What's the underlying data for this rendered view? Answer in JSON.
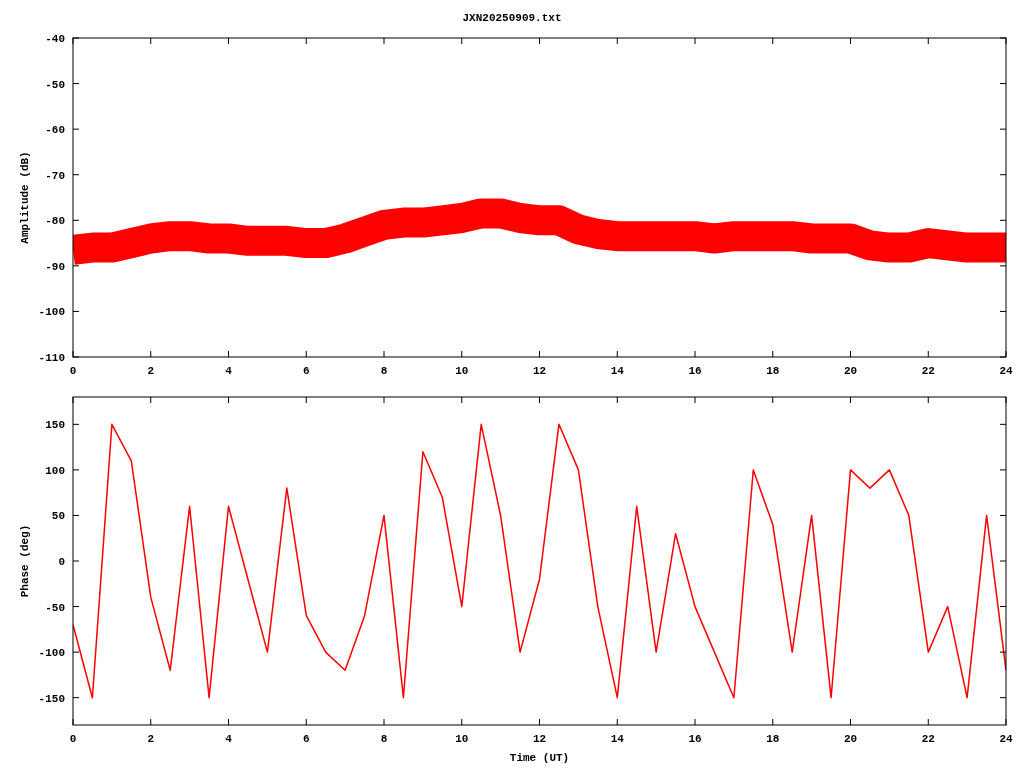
{
  "charts": [
    {
      "chart_data": {
        "type": "line",
        "title": "JXN20250909.txt",
        "ylabel": "Amplitude (dB)",
        "x": [
          0,
          0.5,
          1,
          1.5,
          2,
          2.5,
          3,
          3.5,
          4,
          4.5,
          5,
          5.5,
          6,
          6.5,
          7,
          7.5,
          8,
          8.5,
          9,
          9.5,
          10,
          10.5,
          11,
          11.5,
          12,
          12.5,
          13,
          13.5,
          14,
          14.5,
          15,
          15.5,
          16,
          16.5,
          17,
          17.5,
          18,
          18.5,
          19,
          19.5,
          20,
          20.5,
          21,
          21.5,
          22,
          22.5,
          23,
          23.5,
          24
        ],
        "series": [
          {
            "color": "#ff0000",
            "values": [
              -86.5,
              -86,
              -86,
              -85,
              -84,
              -83.5,
              -83.5,
              -84,
              -84,
              -84.5,
              -84.5,
              -84.5,
              -85,
              -85,
              -84,
              -82.5,
              -81,
              -80.5,
              -80.5,
              -80,
              -79.5,
              -78.5,
              -78.5,
              -79.5,
              -80,
              -80,
              -82,
              -83,
              -83.5,
              -83.5,
              -83.5,
              -83.5,
              -83.5,
              -84,
              -83.5,
              -83.5,
              -83.5,
              -83.5,
              -84,
              -84,
              -84,
              -85.5,
              -86,
              -86,
              -85,
              -85.5,
              -86,
              -86,
              -86
            ]
          }
        ],
        "xlim": [
          0,
          24
        ],
        "ylim": [
          -110,
          -40
        ],
        "xticks": [
          0,
          2,
          4,
          6,
          8,
          10,
          12,
          14,
          16,
          18,
          20,
          22,
          24
        ],
        "yticks": [
          -110,
          -100,
          -90,
          -80,
          -70,
          -60,
          -50,
          -40
        ]
      }
    },
    {
      "chart_data": {
        "type": "line",
        "xlabel": "Time (UT)",
        "ylabel": "Phase (deg)",
        "x": [
          0,
          0.5,
          1,
          1.5,
          2,
          2.5,
          3,
          3.5,
          4,
          4.5,
          5,
          5.5,
          6,
          6.5,
          7,
          7.5,
          8,
          8.5,
          9,
          9.5,
          10,
          10.5,
          11,
          11.5,
          12,
          12.5,
          13,
          13.5,
          14,
          14.5,
          15,
          15.5,
          16,
          16.5,
          17,
          17.5,
          18,
          18.5,
          19,
          19.5,
          20,
          20.5,
          21,
          21.5,
          22,
          22.5,
          23,
          23.5,
          24
        ],
        "series": [
          {
            "color": "#ff0000",
            "values": [
              -70,
              -150,
              150,
              110,
              -40,
              -120,
              60,
              -150,
              60,
              -20,
              -100,
              80,
              -60,
              -100,
              -120,
              -60,
              50,
              -150,
              120,
              70,
              -50,
              150,
              50,
              -100,
              -20,
              150,
              100,
              -50,
              -150,
              60,
              -100,
              30,
              -50,
              -100,
              -150,
              100,
              40,
              -100,
              50,
              -150,
              100,
              80,
              100,
              50,
              -100,
              -50,
              -150,
              50,
              -120
            ]
          }
        ],
        "xlim": [
          0,
          24
        ],
        "ylim": [
          -180,
          180
        ],
        "xticks": [
          0,
          2,
          4,
          6,
          8,
          10,
          12,
          14,
          16,
          18,
          20,
          22,
          24
        ],
        "yticks": [
          -150,
          -100,
          -50,
          0,
          50,
          100,
          150
        ]
      }
    }
  ]
}
